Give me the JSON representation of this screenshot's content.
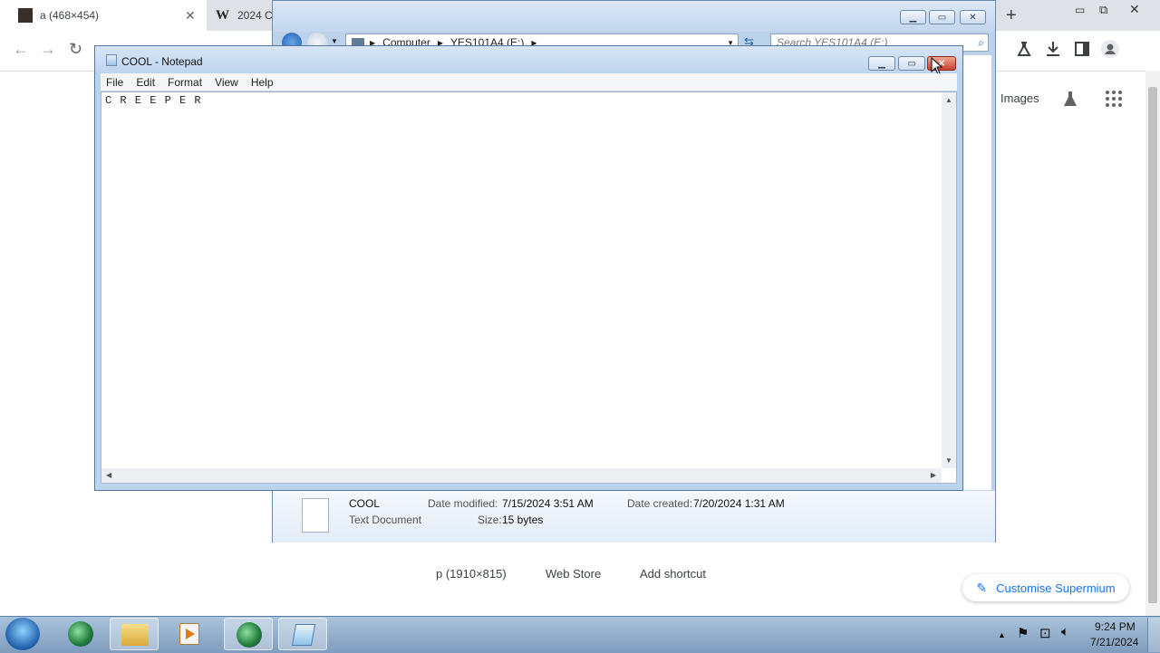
{
  "browser": {
    "tabs": [
      {
        "title": "a (468×454)"
      },
      {
        "title": "2024 C"
      }
    ],
    "toolbar_right": [
      "Images"
    ],
    "new_tab": "+",
    "shortcuts": [
      {
        "label": "p (1910×815)"
      },
      {
        "label": "Web Store"
      },
      {
        "label": "Add shortcut"
      }
    ],
    "customise_label": "Customise Supermium"
  },
  "explorer": {
    "breadcrumb": [
      "Computer",
      "YES101A4 (E:)"
    ],
    "search_placeholder": "Search YES101A4 (E:)",
    "details": {
      "name": "COOL",
      "type": "Text Document",
      "date_modified_label": "Date modified:",
      "date_modified": "7/15/2024 3:51 AM",
      "size_label": "Size:",
      "size": "15 bytes",
      "date_created_label": "Date created:",
      "date_created": "7/20/2024 1:31 AM"
    }
  },
  "notepad": {
    "title": "COOL - Notepad",
    "menu": [
      "File",
      "Edit",
      "Format",
      "View",
      "Help"
    ],
    "content": "C R E E P E R"
  },
  "taskbar": {
    "time": "9:24 PM",
    "date": "7/21/2024"
  }
}
